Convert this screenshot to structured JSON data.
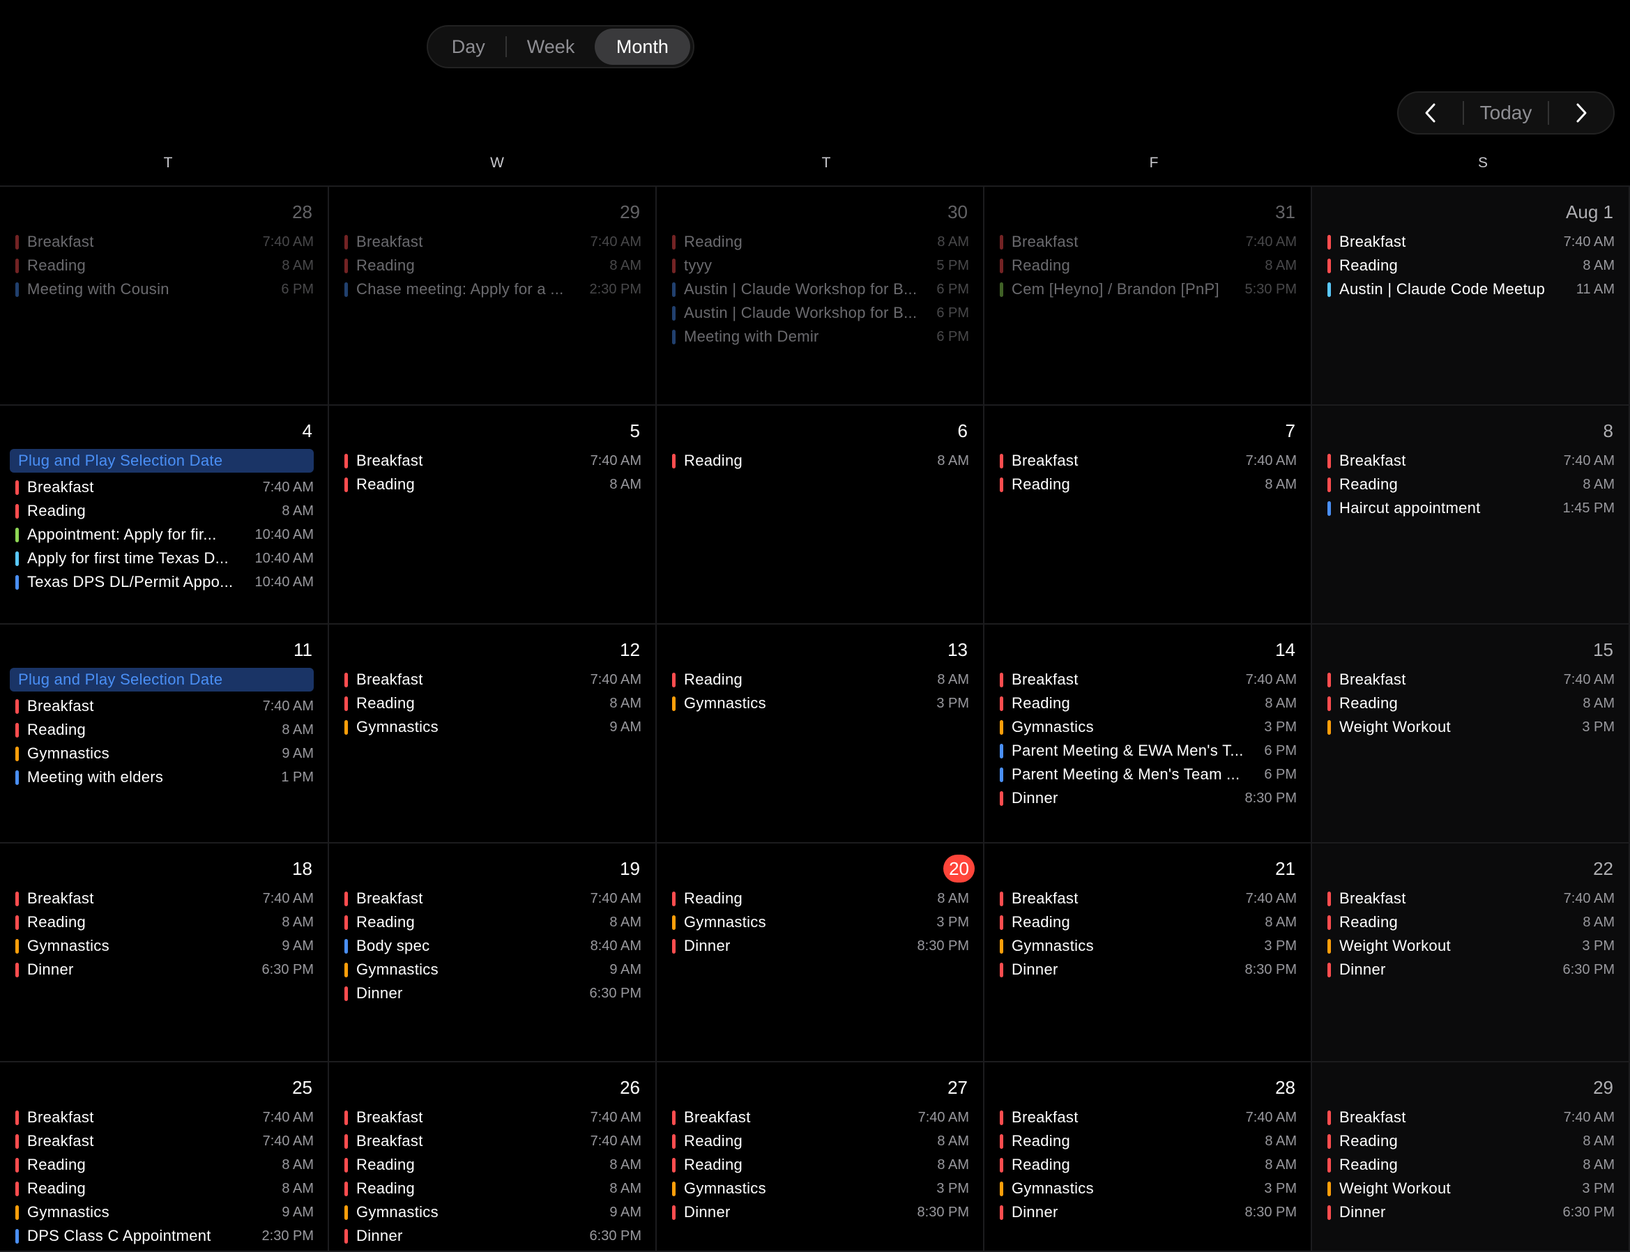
{
  "view_switcher": {
    "day": "Day",
    "week": "Week",
    "month": "Month",
    "selected": "Month"
  },
  "nav": {
    "today": "Today",
    "prev_icon": "chevron-left-icon",
    "next_icon": "chevron-right-icon"
  },
  "weekdays": [
    "T",
    "W",
    "T",
    "F",
    "S"
  ],
  "colors": {
    "red": "#ff4d4f",
    "blue": "#4a8ff5",
    "lightblue": "#5ac8fa",
    "orange": "#ff9f0a",
    "green": "#8ed655",
    "today": "#ff453a"
  },
  "weeks": [
    [
      {
        "date": "28",
        "muted": true,
        "events": [
          {
            "title": "Breakfast",
            "time": "7:40 AM",
            "color": "red"
          },
          {
            "title": "Reading",
            "time": "8 AM",
            "color": "red"
          },
          {
            "title": "Meeting with Cousin",
            "time": "6 PM",
            "color": "blue"
          }
        ]
      },
      {
        "date": "29",
        "muted": true,
        "events": [
          {
            "title": "Breakfast",
            "time": "7:40 AM",
            "color": "red"
          },
          {
            "title": "Reading",
            "time": "8 AM",
            "color": "red"
          },
          {
            "title": "Chase meeting: Apply for a ...",
            "time": "2:30 PM",
            "color": "blue"
          }
        ]
      },
      {
        "date": "30",
        "muted": true,
        "events": [
          {
            "title": "Reading",
            "time": "8 AM",
            "color": "red"
          },
          {
            "title": "tyyy",
            "time": "5 PM",
            "color": "red"
          },
          {
            "title": "Austin | Claude Workshop for B...",
            "time": "6 PM",
            "color": "blue"
          },
          {
            "title": "Austin | Claude Workshop for B...",
            "time": "6 PM",
            "color": "blue"
          },
          {
            "title": "Meeting with Demir",
            "time": "6 PM",
            "color": "blue"
          }
        ]
      },
      {
        "date": "31",
        "muted": true,
        "events": [
          {
            "title": "Breakfast",
            "time": "7:40 AM",
            "color": "red"
          },
          {
            "title": "Reading",
            "time": "8 AM",
            "color": "red"
          },
          {
            "title": "Cem [Heyno] / Brandon [PnP]",
            "time": "5:30 PM",
            "color": "green"
          }
        ]
      },
      {
        "date": "Aug 1",
        "events": [
          {
            "title": "Breakfast",
            "time": "7:40 AM",
            "color": "red"
          },
          {
            "title": "Reading",
            "time": "8 AM",
            "color": "red"
          },
          {
            "title": "Austin | Claude Code Meetup",
            "time": "11 AM",
            "color": "lightblue"
          }
        ]
      }
    ],
    [
      {
        "date": "4",
        "allday": "Plug and Play Selection Date",
        "events": [
          {
            "title": "Breakfast",
            "time": "7:40 AM",
            "color": "red"
          },
          {
            "title": "Reading",
            "time": "8 AM",
            "color": "red"
          },
          {
            "title": "Appointment: Apply for fir...",
            "time": "10:40 AM",
            "color": "green"
          },
          {
            "title": "Apply for first time Texas D...",
            "time": "10:40 AM",
            "color": "lightblue"
          },
          {
            "title": "Texas DPS DL/Permit Appo...",
            "time": "10:40 AM",
            "color": "blue"
          }
        ]
      },
      {
        "date": "5",
        "events": [
          {
            "title": "Breakfast",
            "time": "7:40 AM",
            "color": "red"
          },
          {
            "title": "Reading",
            "time": "8 AM",
            "color": "red"
          }
        ]
      },
      {
        "date": "6",
        "events": [
          {
            "title": "Reading",
            "time": "8 AM",
            "color": "red"
          }
        ]
      },
      {
        "date": "7",
        "events": [
          {
            "title": "Breakfast",
            "time": "7:40 AM",
            "color": "red"
          },
          {
            "title": "Reading",
            "time": "8 AM",
            "color": "red"
          }
        ]
      },
      {
        "date": "8",
        "events": [
          {
            "title": "Breakfast",
            "time": "7:40 AM",
            "color": "red"
          },
          {
            "title": "Reading",
            "time": "8 AM",
            "color": "red"
          },
          {
            "title": "Haircut appointment",
            "time": "1:45 PM",
            "color": "blue"
          }
        ]
      }
    ],
    [
      {
        "date": "11",
        "allday": "Plug and Play Selection Date",
        "events": [
          {
            "title": "Breakfast",
            "time": "7:40 AM",
            "color": "red"
          },
          {
            "title": "Reading",
            "time": "8 AM",
            "color": "red"
          },
          {
            "title": "Gymnastics",
            "time": "9 AM",
            "color": "orange"
          },
          {
            "title": "Meeting with elders",
            "time": "1 PM",
            "color": "blue"
          }
        ]
      },
      {
        "date": "12",
        "events": [
          {
            "title": "Breakfast",
            "time": "7:40 AM",
            "color": "red"
          },
          {
            "title": "Reading",
            "time": "8 AM",
            "color": "red"
          },
          {
            "title": "Gymnastics",
            "time": "9 AM",
            "color": "orange"
          }
        ]
      },
      {
        "date": "13",
        "events": [
          {
            "title": "Reading",
            "time": "8 AM",
            "color": "red"
          },
          {
            "title": "Gymnastics",
            "time": "3 PM",
            "color": "orange"
          }
        ]
      },
      {
        "date": "14",
        "events": [
          {
            "title": "Breakfast",
            "time": "7:40 AM",
            "color": "red"
          },
          {
            "title": "Reading",
            "time": "8 AM",
            "color": "red"
          },
          {
            "title": "Gymnastics",
            "time": "3 PM",
            "color": "orange"
          },
          {
            "title": "Parent Meeting & EWA Men's T...",
            "time": "6 PM",
            "color": "blue"
          },
          {
            "title": "Parent Meeting & Men's Team ...",
            "time": "6 PM",
            "color": "blue"
          },
          {
            "title": "Dinner",
            "time": "8:30 PM",
            "color": "red"
          }
        ]
      },
      {
        "date": "15",
        "events": [
          {
            "title": "Breakfast",
            "time": "7:40 AM",
            "color": "red"
          },
          {
            "title": "Reading",
            "time": "8 AM",
            "color": "red"
          },
          {
            "title": "Weight Workout",
            "time": "3 PM",
            "color": "orange"
          }
        ]
      }
    ],
    [
      {
        "date": "18",
        "events": [
          {
            "title": "Breakfast",
            "time": "7:40 AM",
            "color": "red"
          },
          {
            "title": "Reading",
            "time": "8 AM",
            "color": "red"
          },
          {
            "title": "Gymnastics",
            "time": "9 AM",
            "color": "orange"
          },
          {
            "title": "Dinner",
            "time": "6:30 PM",
            "color": "red"
          }
        ]
      },
      {
        "date": "19",
        "events": [
          {
            "title": "Breakfast",
            "time": "7:40 AM",
            "color": "red"
          },
          {
            "title": "Reading",
            "time": "8 AM",
            "color": "red"
          },
          {
            "title": "Body spec",
            "time": "8:40 AM",
            "color": "blue"
          },
          {
            "title": "Gymnastics",
            "time": "9 AM",
            "color": "orange"
          },
          {
            "title": "Dinner",
            "time": "6:30 PM",
            "color": "red"
          }
        ]
      },
      {
        "date": "20",
        "today": true,
        "events": [
          {
            "title": "Reading",
            "time": "8 AM",
            "color": "red"
          },
          {
            "title": "Gymnastics",
            "time": "3 PM",
            "color": "orange"
          },
          {
            "title": "Dinner",
            "time": "8:30 PM",
            "color": "red"
          }
        ]
      },
      {
        "date": "21",
        "events": [
          {
            "title": "Breakfast",
            "time": "7:40 AM",
            "color": "red"
          },
          {
            "title": "Reading",
            "time": "8 AM",
            "color": "red"
          },
          {
            "title": "Gymnastics",
            "time": "3 PM",
            "color": "orange"
          },
          {
            "title": "Dinner",
            "time": "8:30 PM",
            "color": "red"
          }
        ]
      },
      {
        "date": "22",
        "events": [
          {
            "title": "Breakfast",
            "time": "7:40 AM",
            "color": "red"
          },
          {
            "title": "Reading",
            "time": "8 AM",
            "color": "red"
          },
          {
            "title": "Weight Workout",
            "time": "3 PM",
            "color": "orange"
          },
          {
            "title": "Dinner",
            "time": "6:30 PM",
            "color": "red"
          }
        ]
      }
    ],
    [
      {
        "date": "25",
        "events": [
          {
            "title": "Breakfast",
            "time": "7:40 AM",
            "color": "red"
          },
          {
            "title": "Breakfast",
            "time": "7:40 AM",
            "color": "red"
          },
          {
            "title": "Reading",
            "time": "8 AM",
            "color": "red"
          },
          {
            "title": "Reading",
            "time": "8 AM",
            "color": "red"
          },
          {
            "title": "Gymnastics",
            "time": "9 AM",
            "color": "orange"
          },
          {
            "title": "DPS Class C Appointment",
            "time": "2:30 PM",
            "color": "blue"
          }
        ]
      },
      {
        "date": "26",
        "events": [
          {
            "title": "Breakfast",
            "time": "7:40 AM",
            "color": "red"
          },
          {
            "title": "Breakfast",
            "time": "7:40 AM",
            "color": "red"
          },
          {
            "title": "Reading",
            "time": "8 AM",
            "color": "red"
          },
          {
            "title": "Reading",
            "time": "8 AM",
            "color": "red"
          },
          {
            "title": "Gymnastics",
            "time": "9 AM",
            "color": "orange"
          },
          {
            "title": "Dinner",
            "time": "6:30 PM",
            "color": "red"
          }
        ]
      },
      {
        "date": "27",
        "events": [
          {
            "title": "Breakfast",
            "time": "7:40 AM",
            "color": "red"
          },
          {
            "title": "Reading",
            "time": "8 AM",
            "color": "red"
          },
          {
            "title": "Reading",
            "time": "8 AM",
            "color": "red"
          },
          {
            "title": "Gymnastics",
            "time": "3 PM",
            "color": "orange"
          },
          {
            "title": "Dinner",
            "time": "8:30 PM",
            "color": "red"
          }
        ]
      },
      {
        "date": "28",
        "events": [
          {
            "title": "Breakfast",
            "time": "7:40 AM",
            "color": "red"
          },
          {
            "title": "Reading",
            "time": "8 AM",
            "color": "red"
          },
          {
            "title": "Reading",
            "time": "8 AM",
            "color": "red"
          },
          {
            "title": "Gymnastics",
            "time": "3 PM",
            "color": "orange"
          },
          {
            "title": "Dinner",
            "time": "8:30 PM",
            "color": "red"
          }
        ]
      },
      {
        "date": "29",
        "events": [
          {
            "title": "Breakfast",
            "time": "7:40 AM",
            "color": "red"
          },
          {
            "title": "Reading",
            "time": "8 AM",
            "color": "red"
          },
          {
            "title": "Reading",
            "time": "8 AM",
            "color": "red"
          },
          {
            "title": "Weight Workout",
            "time": "3 PM",
            "color": "orange"
          },
          {
            "title": "Dinner",
            "time": "6:30 PM",
            "color": "red"
          }
        ]
      }
    ]
  ]
}
